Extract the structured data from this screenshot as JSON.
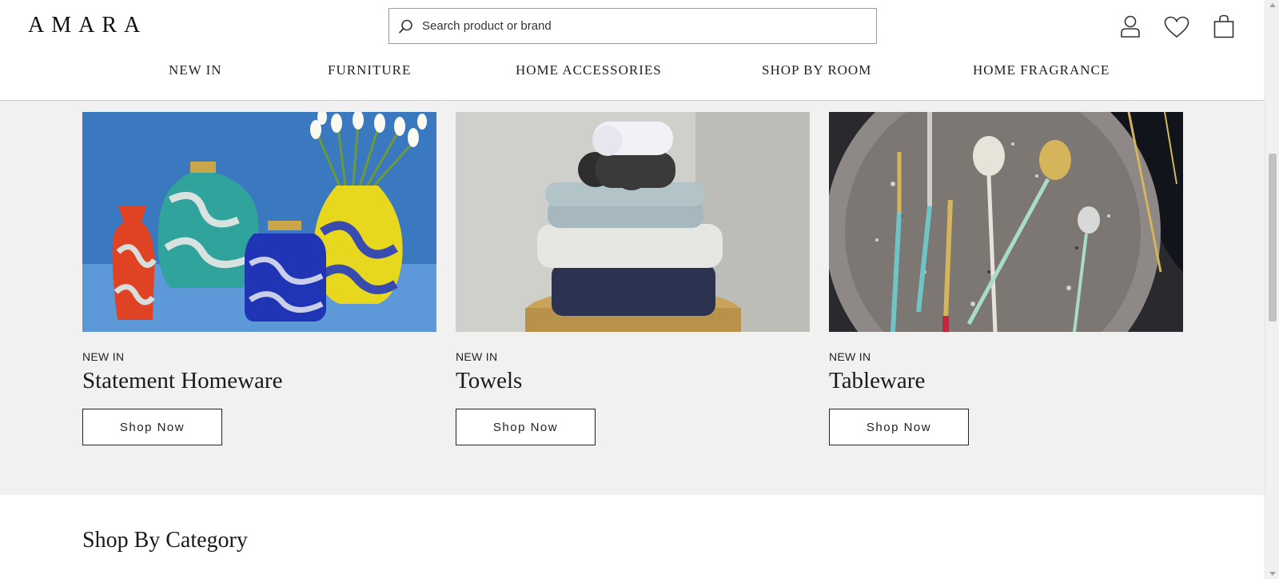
{
  "header": {
    "logo": "AMARA",
    "search": {
      "placeholder": "Search product or brand"
    },
    "icons": [
      "account-icon",
      "wishlist-heart-icon",
      "shopping-bag-icon"
    ]
  },
  "nav": {
    "items": [
      {
        "label": "NEW IN"
      },
      {
        "label": "FURNITURE"
      },
      {
        "label": "HOME ACCESSORIES"
      },
      {
        "label": "SHOP BY ROOM"
      },
      {
        "label": "HOME FRAGRANCE"
      }
    ]
  },
  "promos": [
    {
      "kicker": "NEW IN",
      "title": "Statement Homeware",
      "button": "Shop Now"
    },
    {
      "kicker": "NEW IN",
      "title": "Towels",
      "button": "Shop Now"
    },
    {
      "kicker": "NEW IN",
      "title": "Tableware",
      "button": "Shop Now"
    }
  ],
  "category": {
    "title": "Shop By Category"
  },
  "colors": {
    "promo_bg": "#f1f1f1",
    "text": "#1a1a1a",
    "border": "#222222"
  }
}
